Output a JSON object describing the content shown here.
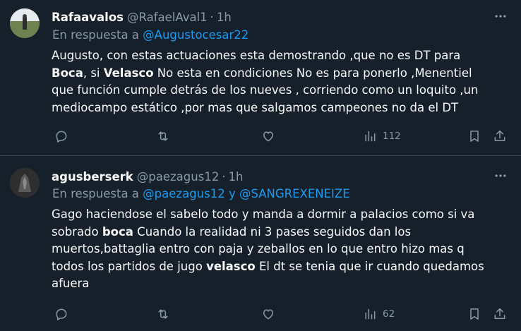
{
  "tweets": [
    {
      "name": "Rafaavalos",
      "handle": "@RafaelAval1",
      "separator": "·",
      "time": "1h",
      "reply_prefix": "En respuesta a",
      "reply_to": "@Augustocesar22",
      "lines": [
        {
          "parts": [
            "Augusto, con estas actuaciones esta demostrando ,que no es DT para"
          ]
        },
        {
          "bold1": "Boca",
          "mid": ", si ",
          "bold2": "Velasco",
          "rest": " No esta en condiciones No es para ponerlo ,Menentiel"
        },
        {
          "parts": [
            "que función cumple detrás de los nueves , corriendo como un loquito ,un"
          ]
        },
        {
          "parts": [
            "mediocampo estático ,por mas que salgamos campeones no da el DT"
          ]
        }
      ],
      "views": "112"
    },
    {
      "name": "agusberserk",
      "handle": "@paezagus12",
      "separator": "·",
      "time": "1h",
      "reply_prefix": "En respuesta a",
      "reply_to_1": "@paezagus12",
      "reply_join": "y",
      "reply_to_2": "@SANGREXENEIZE",
      "lines": [
        {
          "parts": [
            "Gago haciendose el sabelo todo y manda a dormir a palacios como si va"
          ]
        },
        {
          "pre": "sobrado ",
          "bold": "boca",
          "rest": " Cuando la realidad ni 3 pases seguidos dan los"
        },
        {
          "parts": [
            "muertos,battaglia entro con paja y zeballos en lo que entro hizo mas q"
          ]
        },
        {
          "pre": "todos los partidos de jugo ",
          "bold": "velasco",
          "rest": " El dt se tenia que ir cuando quedamos"
        },
        {
          "parts": [
            "afuera"
          ]
        }
      ],
      "views": "62"
    }
  ],
  "icons": {
    "more": "more-horizontal-icon",
    "reply": "reply-bubble-icon",
    "retweet": "retweet-icon",
    "like": "heart-icon",
    "views": "bar-chart-icon",
    "bookmark": "bookmark-icon",
    "share": "share-icon"
  },
  "colors": {
    "background": "#15202b",
    "text": "#f7f9f9",
    "muted": "#8b98a5",
    "link": "#1d9bf0",
    "divider": "#38444d"
  }
}
